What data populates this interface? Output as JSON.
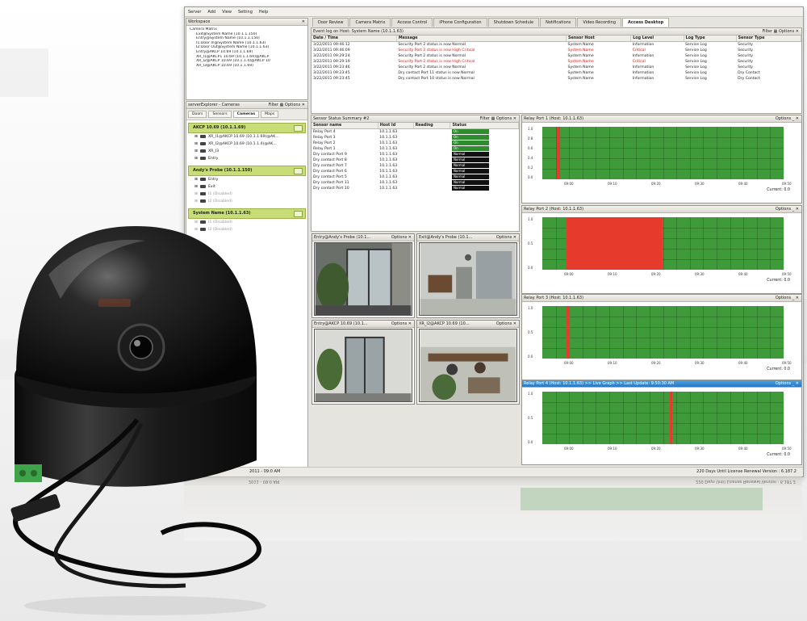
{
  "menu": [
    "Server",
    "Add",
    "View",
    "Setting",
    "Help"
  ],
  "workspace": {
    "title": "Workspace",
    "items": [
      "Camera Matrix",
      "Exit@System Name (10.1.1.150)",
      "Entry@System Name (10.1.1.150)",
      "I1:Door In@System Name (10.1.1.63)",
      "I2:Door Out@System Name (10.1.1.63)",
      "Entry@AKCP 10.69 (10.1.1.69)",
      "XR_I1@AKCP1 10.69 (10.1.1.69)@AKCP",
      "XR_I2@AKCP 10.69 (10.1.1.4)@AKCP 10",
      "XR_I3@AKCP 10.69 (10.1.1.69)"
    ]
  },
  "explorer": {
    "title": "serverExplorer - Cameras",
    "filter": "Filter",
    "options": "Options",
    "tabs": [
      "Doors",
      "Sensors",
      "Cameras",
      "Maps"
    ],
    "groups": [
      {
        "name": "AKCP 10.69 (10.1.1.69)",
        "items": [
          "XR_I1@AKCP 10.69 (10.1.1.69)@AK...",
          "XR_I2@AKCP 10.69 (10.1.1.4)@AK...",
          "XR_I3",
          "Entry"
        ]
      },
      {
        "name": "Andy's Probe (10.1.1.150)",
        "items": [
          "Entry",
          "Exit",
          "I1 (Disabled)",
          "I2 (Disabled)"
        ]
      },
      {
        "name": "System Name (10.1.1.63)",
        "items": [
          "I1 (Disabled)",
          "I2 (Disabled)"
        ]
      }
    ]
  },
  "tabs": [
    "Door Review",
    "Camera Matrix",
    "Access Control",
    "iPhone Configuration",
    "Shutdown Schedule",
    "Notifications",
    "Video Recording",
    "Access Desktop"
  ],
  "eventlog": {
    "title": "Event log on Host: System Name (10.1.1.63)",
    "filter": "Filter",
    "options": "Options",
    "headers": [
      "Date / Time",
      "Message",
      "Sensor Host",
      "Log Level",
      "Log Type",
      "Sensor Type"
    ],
    "rows": [
      {
        "time": "3/22/2011 09:46:12",
        "msg": "Security Port 2 status is now Normal",
        "host": "System Name",
        "level": "Information",
        "type": "Service Log",
        "stype": "Security",
        "crit": false
      },
      {
        "time": "3/22/2011 09:46:09",
        "msg": "Security Port 2 status is now High Critical",
        "host": "System Name",
        "level": "Critical",
        "type": "Service Log",
        "stype": "Security",
        "crit": true
      },
      {
        "time": "3/22/2011 09:29:24",
        "msg": "Security Port 2 status is now Normal",
        "host": "System Name",
        "level": "Information",
        "type": "Service Log",
        "stype": "Security",
        "crit": false
      },
      {
        "time": "3/22/2011 09:29:19",
        "msg": "Security Port 2 status is now High Critical",
        "host": "System Name",
        "level": "Critical",
        "type": "Service Log",
        "stype": "Security",
        "crit": true
      },
      {
        "time": "3/22/2011 09:23:46",
        "msg": "Security Port 2 status is now Normal",
        "host": "System Name",
        "level": "Information",
        "type": "Service Log",
        "stype": "Security",
        "crit": false
      },
      {
        "time": "3/22/2011 09:23:45",
        "msg": "Dry contact Port 11 status is now Normal",
        "host": "System Name",
        "level": "Information",
        "type": "Service Log",
        "stype": "Dry Contact",
        "crit": false
      },
      {
        "time": "3/22/2011 09:23:45",
        "msg": "Dry contact Port 10 status is now Normal",
        "host": "System Name",
        "level": "Information",
        "type": "Service Log",
        "stype": "Dry Contact",
        "crit": false
      }
    ]
  },
  "sensorstatus": {
    "title": "Sensor Status Summary #2",
    "filter": "Filter",
    "options": "Options",
    "headers": [
      "Sensor name",
      "Host Id",
      "Reading",
      "Status"
    ],
    "rows": [
      {
        "name": "Relay Port 4",
        "host": "10.1.1.63",
        "status": "On",
        "color": "#2e8b2e"
      },
      {
        "name": "Relay Port 3",
        "host": "10.1.1.63",
        "status": "On",
        "color": "#2e8b2e"
      },
      {
        "name": "Relay Port 2",
        "host": "10.1.1.63",
        "status": "On",
        "color": "#2e8b2e"
      },
      {
        "name": "Relay Port 1",
        "host": "10.1.1.63",
        "status": "On",
        "color": "#2e8b2e"
      },
      {
        "name": "Dry contact Port 9",
        "host": "10.1.1.63",
        "status": "Normal",
        "color": "#111111"
      },
      {
        "name": "Dry contact Port 8",
        "host": "10.1.1.63",
        "status": "Normal",
        "color": "#111111"
      },
      {
        "name": "Dry contact Port 7",
        "host": "10.1.1.63",
        "status": "Normal",
        "color": "#111111"
      },
      {
        "name": "Dry contact Port 6",
        "host": "10.1.1.63",
        "status": "Normal",
        "color": "#111111"
      },
      {
        "name": "Dry contact Port 5",
        "host": "10.1.1.63",
        "status": "Normal",
        "color": "#111111"
      },
      {
        "name": "Dry contact Port 11",
        "host": "10.1.1.63",
        "status": "Normal",
        "color": "#111111"
      },
      {
        "name": "Dry contact Port 10",
        "host": "10.1.1.63",
        "status": "Normal",
        "color": "#111111"
      }
    ]
  },
  "cameras": [
    {
      "title": "Entry@Andy's Probe (10.1...",
      "options": "Options"
    },
    {
      "title": "Exit@Andy's Probe (10.1...",
      "options": "Options"
    },
    {
      "title": "Entry@AKCP 10.69 (10.1...",
      "options": "Options"
    },
    {
      "title": "XR_I2@AKCP 10.69 (10...",
      "options": "Options"
    }
  ],
  "relays": [
    {
      "title": "Relay Port 1 (Host: 10.1.1.63)",
      "options": "Options",
      "current": "Current: 0.0",
      "active": false
    },
    {
      "title": "Relay Port 2 (Host: 10.1.1.63)",
      "options": "Options",
      "current": "Current: 0.0",
      "active": false
    },
    {
      "title": "Relay Port 3 (Host: 10.1.1.63)",
      "options": "Options",
      "current": "Current: 0.0",
      "active": false
    },
    {
      "title": "Relay Port 4 (Host: 10.1.1.63) >> Live Graph >> Last Update: 9:50:30 AM",
      "options": "Options",
      "current": "Current: 0.0",
      "active": true
    }
  ],
  "chart_data": [
    {
      "type": "area",
      "title": "Relay Port 1 (Host: 10.1.1.63)",
      "x_ticks": [
        "09:00",
        "09:10",
        "09:20",
        "09:30",
        "09:40",
        "09:50"
      ],
      "y_ticks": [
        "1.0",
        "0.8",
        "0.6",
        "0.4",
        "0.2",
        "0.0"
      ],
      "ylim": [
        0,
        1
      ],
      "red_spans": [
        [
          0.06,
          0.075
        ]
      ]
    },
    {
      "type": "area",
      "title": "Relay Port 2 (Host: 10.1.1.63)",
      "x_ticks": [
        "09:00",
        "09:10",
        "09:20",
        "09:30",
        "09:40",
        "09:50"
      ],
      "y_ticks": [
        "1.0",
        "0.5",
        "0.0"
      ],
      "ylim": [
        0,
        1
      ],
      "red_spans": [
        [
          0.1,
          0.5
        ]
      ]
    },
    {
      "type": "area",
      "title": "Relay Port 3 (Host: 10.1.1.63)",
      "x_ticks": [
        "09:00",
        "09:10",
        "09:20",
        "09:30",
        "09:40",
        "09:50"
      ],
      "y_ticks": [
        "1.0",
        "0.5",
        "0.0"
      ],
      "ylim": [
        0,
        1
      ],
      "red_spans": [
        [
          0.1,
          0.115
        ]
      ]
    },
    {
      "type": "area",
      "title": "Relay Port 4 (Host: 10.1.1.63)",
      "x_ticks": [
        "09:00",
        "09:10",
        "09:20",
        "09:30",
        "09:40",
        "09:50"
      ],
      "y_ticks": [
        "1.0",
        "0.5",
        "0.0"
      ],
      "ylim": [
        0,
        1
      ],
      "red_spans": [
        [
          0.53,
          0.54
        ]
      ]
    }
  ],
  "status": {
    "left": "2011 - 09:0 AM",
    "right": "220 Days Until License Renewal   Version : 6.187.2"
  }
}
